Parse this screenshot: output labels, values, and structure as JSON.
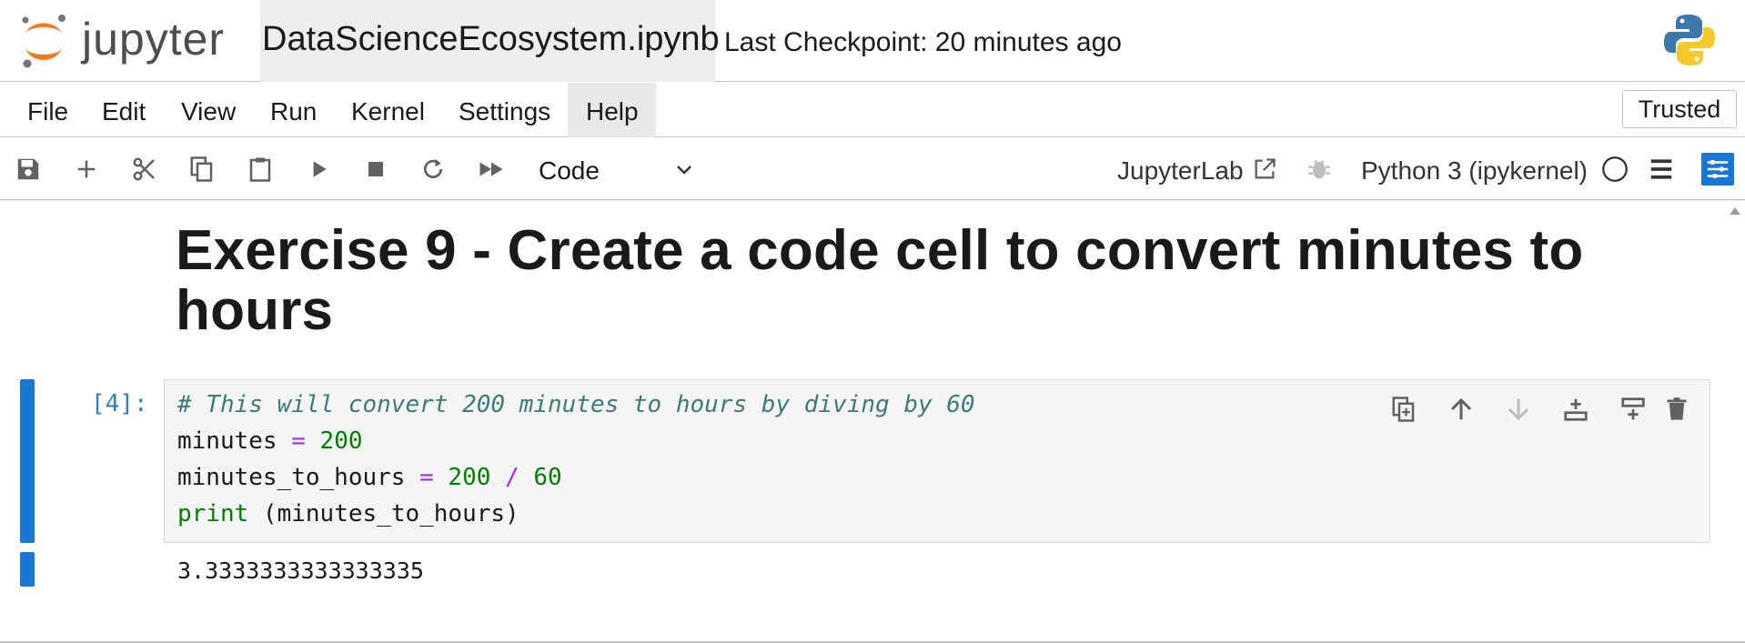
{
  "header": {
    "logo_text": "jupyter",
    "notebook_title": "DataScienceEcosystem.ipynb",
    "checkpoint": "Last Checkpoint: 20 minutes ago"
  },
  "menubar": {
    "items": [
      "File",
      "Edit",
      "View",
      "Run",
      "Kernel",
      "Settings",
      "Help"
    ],
    "trusted": "Trusted"
  },
  "toolbar": {
    "cell_type": "Code",
    "jupyterlab_label": "JupyterLab",
    "kernel_name": "Python 3 (ipykernel)",
    "icons": [
      "save-icon",
      "add-cell-icon",
      "cut-icon",
      "copy-icon",
      "paste-icon",
      "run-icon",
      "stop-icon",
      "restart-icon",
      "fast-forward-icon"
    ]
  },
  "notebook": {
    "heading": "Exercise 9 - Create a code cell to convert minutes to hours",
    "cell": {
      "prompt": "[4]:",
      "code": {
        "comment": "# This will convert 200 minutes to hours by diving by 60",
        "line2_var": "minutes",
        "line2_op": "=",
        "line2_num": "200",
        "line3_var": "minutes_to_hours",
        "line3_op": "=",
        "line3_num1": "200",
        "line3_div": "/",
        "line3_num2": "60",
        "line4_fn": "print",
        "line4_rest": " (minutes_to_hours)"
      },
      "output": "3.3333333333333335"
    }
  },
  "colors": {
    "accent": "#1976d2",
    "prompt": "#307fc1",
    "comment": "#3d7a7a",
    "operator": "#aa22ff",
    "number": "#008000"
  }
}
